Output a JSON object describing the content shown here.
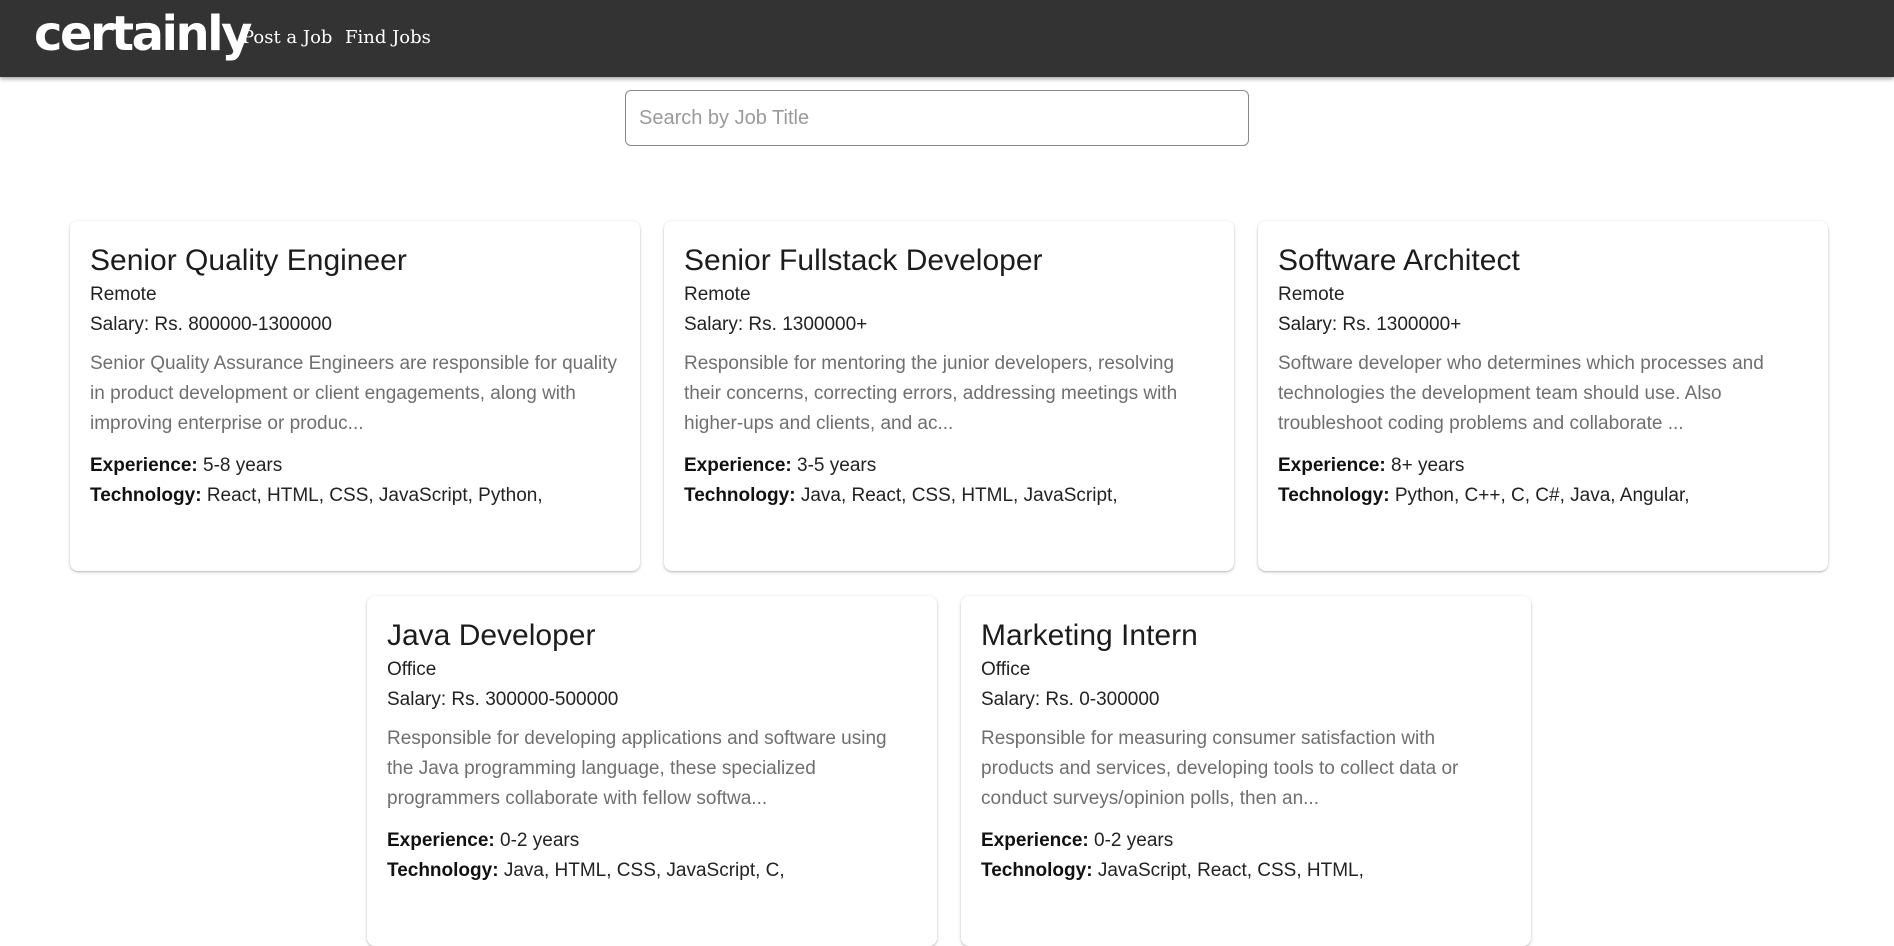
{
  "header": {
    "logo": "certainly",
    "nav": [
      {
        "label": "Post a Job"
      },
      {
        "label": "Find Jobs"
      }
    ]
  },
  "search": {
    "placeholder": "Search by Job Title",
    "value": ""
  },
  "labels": {
    "experience": "Experience:",
    "technology": "Technology:"
  },
  "jobs": [
    {
      "title": "Senior Quality Engineer",
      "location": "Remote",
      "salary": "Salary: Rs. 800000-1300000",
      "description": "Senior Quality Assurance Engineers are responsible for quality in product development or client engagements, along with improving enterprise or produc...",
      "experience": "5-8 years",
      "technology": "React, HTML, CSS, JavaScript, Python,"
    },
    {
      "title": "Senior Fullstack Developer",
      "location": "Remote",
      "salary": "Salary: Rs. 1300000+",
      "description": "Responsible for mentoring the junior developers, resolving their concerns, correcting errors, addressing meetings with higher-ups and clients, and ac...",
      "experience": "3-5 years",
      "technology": "Java, React, CSS, HTML, JavaScript,"
    },
    {
      "title": "Software Architect",
      "location": "Remote",
      "salary": "Salary: Rs. 1300000+",
      "description": "Software developer who determines which processes and technologies the development team should use. Also troubleshoot coding problems and collaborate ...",
      "experience": "8+ years",
      "technology": "Python, C++, C, C#, Java, Angular,"
    },
    {
      "title": "Java Developer",
      "location": "Office",
      "salary": "Salary: Rs. 300000-500000",
      "description": "Responsible for developing applications and software using the Java programming language, these specialized programmers collaborate with fellow softwa...",
      "experience": "0-2 years",
      "technology": "Java, HTML, CSS, JavaScript, C,"
    },
    {
      "title": "Marketing Intern",
      "location": "Office",
      "salary": "Salary: Rs. 0-300000",
      "description": "Responsible for measuring consumer satisfaction with products and services, developing tools to collect data or conduct surveys/opinion polls, then an...",
      "experience": "0-2 years",
      "technology": "JavaScript, React, CSS, HTML,"
    }
  ],
  "colors": {
    "navbar": "#333333",
    "text": "#1c1c1c",
    "description": "#6f6f6f"
  }
}
